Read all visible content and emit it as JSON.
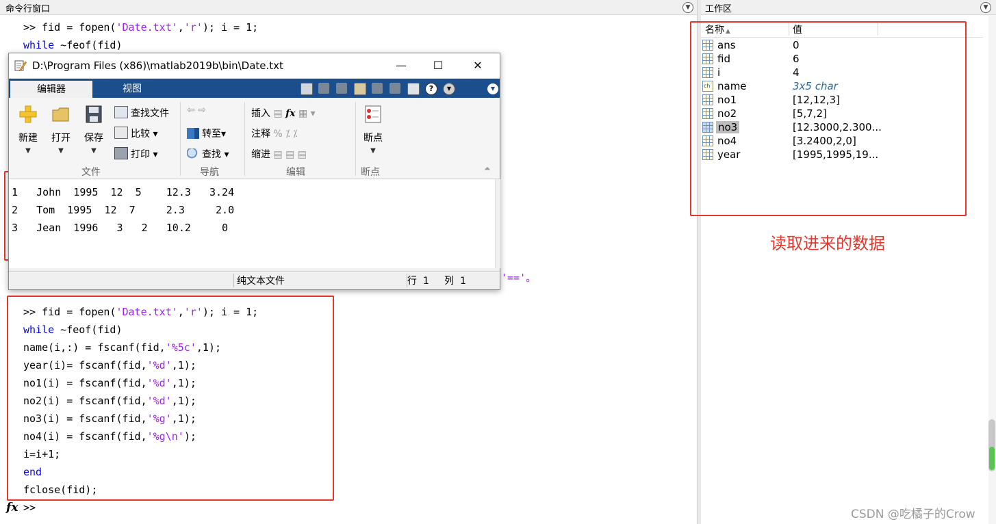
{
  "command_window": {
    "title": "命令行窗口",
    "menu_glyph": "▼",
    "top_lines": [
      ">> fid = fopen(",
      "'Date.txt'",
      ",",
      "'r'",
      "); i = 1;"
    ],
    "top_while_kw": "while",
    "top_while_rest": " ~feof(fid)",
    "trail_text": "'=='。",
    "code_block": {
      "l1_a": ">> fid = fopen(",
      "l1_s1": "'Date.txt'",
      "l1_b": ",",
      "l1_s2": "'r'",
      "l1_c": "); i = 1;",
      "l2_kw": "while",
      "l2_rest": " ~feof(fid)",
      "l3_a": "name(i,:) = fscanf(fid,",
      "l3_s": "'%5c'",
      "l3_b": ",1);",
      "l4_a": "year(i)= fscanf(fid,",
      "l4_s": "'%d'",
      "l4_b": ",1);",
      "l5_a": "no1(i) = fscanf(fid,",
      "l5_s": "'%d'",
      "l5_b": ",1);",
      "l6_a": "no2(i) = fscanf(fid,",
      "l6_s": "'%d'",
      "l6_b": ",1);",
      "l7_a": "no3(i) = fscanf(fid,",
      "l7_s": "'%g'",
      "l7_b": ",1);",
      "l8_a": "no4(i) = fscanf(fid,",
      "l8_s": "'%g\\n'",
      "l8_b": ");",
      "l9": "i=i+1;",
      "l10_kw": "end",
      "l11": "fclose(fid);"
    },
    "fx_label": "fx",
    "prompt": ">>"
  },
  "editor": {
    "title": "D:\\Program Files (x86)\\matlab2019b\\bin\\Date.txt",
    "minimize": "—",
    "maximize": "☐",
    "close": "✕",
    "tabs": {
      "editor": "编辑器",
      "view": "视图"
    },
    "ribbon": {
      "new": "新建",
      "open": "打开",
      "save": "保存",
      "find_files": "查找文件",
      "compare": "比较",
      "print": "打印",
      "goto": "转至",
      "find": "查找",
      "insert": "插入",
      "comment": "注释",
      "indent": "缩进",
      "breakpoints": "断点",
      "sections": {
        "file": "文件",
        "navigate": "导航",
        "edit": "编辑",
        "breakpoints": "断点"
      }
    },
    "lines": [
      "1   John  1995  12  5    12.3   3.24",
      "2   Tom  1995  12  7     2.3     2.0",
      "3   Jean  1996   3   2   10.2     0"
    ],
    "status": {
      "file_type": "纯文本文件",
      "position": "行  1     列  1"
    }
  },
  "workspace": {
    "title": "工作区",
    "columns": {
      "name": "名称",
      "sort_glyph": "▲",
      "value": "值"
    },
    "variables": [
      {
        "name": "ans",
        "value": "0"
      },
      {
        "name": "fid",
        "value": "6"
      },
      {
        "name": "i",
        "value": "4"
      },
      {
        "name": "name",
        "value": "3x5 char"
      },
      {
        "name": "no1",
        "value": "[12,12,3]"
      },
      {
        "name": "no2",
        "value": "[5,7,2]"
      },
      {
        "name": "no3",
        "value": "[12.3000,2.300..."
      },
      {
        "name": "no4",
        "value": "[3.2400,2,0]"
      },
      {
        "name": "year",
        "value": "[1995,1995,19..."
      }
    ],
    "annotation": "读取进来的数据",
    "watermark": "CSDN @吃橘子的Crow"
  },
  "colors": {
    "accent_blue": "#1a4e8c",
    "annotation_red": "#e8352b",
    "keyword_blue": "#0000ff",
    "string_purple": "#a020f0"
  }
}
